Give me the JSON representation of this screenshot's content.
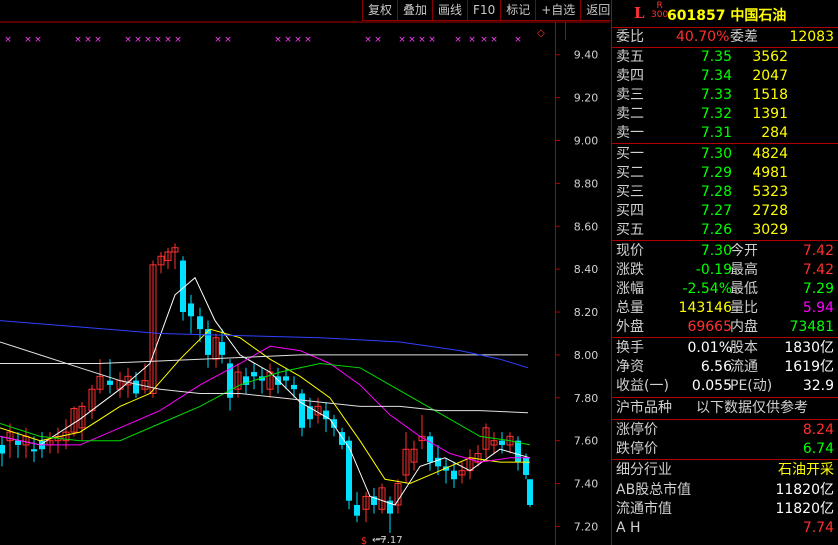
{
  "toolbar": [
    "复权",
    "叠加",
    "画线",
    "F10",
    "标记",
    "+自选",
    "返回"
  ],
  "stock": {
    "prefix": "L",
    "badge_top": "R",
    "badge_bottom": "300",
    "code_name": "601857 中国石油"
  },
  "weibi": {
    "label1": "委比",
    "value1": "40.70%",
    "label2": "委差",
    "value2": "12083"
  },
  "asks": [
    {
      "label": "卖五",
      "price": "7.35",
      "vol": "3562"
    },
    {
      "label": "卖四",
      "price": "7.34",
      "vol": "2047"
    },
    {
      "label": "卖三",
      "price": "7.33",
      "vol": "1518"
    },
    {
      "label": "卖二",
      "price": "7.32",
      "vol": "1391"
    },
    {
      "label": "卖一",
      "price": "7.31",
      "vol": "284"
    }
  ],
  "bids": [
    {
      "label": "买一",
      "price": "7.30",
      "vol": "4824"
    },
    {
      "label": "买二",
      "price": "7.29",
      "vol": "4981"
    },
    {
      "label": "买三",
      "price": "7.28",
      "vol": "5323"
    },
    {
      "label": "买四",
      "price": "7.27",
      "vol": "2728"
    },
    {
      "label": "买五",
      "price": "7.26",
      "vol": "3029"
    }
  ],
  "quote": [
    {
      "l1": "现价",
      "v1": "7.30",
      "l2": "今开",
      "v2": "7.42",
      "c1": "green",
      "c2": "red"
    },
    {
      "l1": "涨跌",
      "v1": "-0.19",
      "l2": "最高",
      "v2": "7.42",
      "c1": "green",
      "c2": "red"
    },
    {
      "l1": "涨幅",
      "v1": "-2.54%",
      "l2": "最低",
      "v2": "7.29",
      "c1": "green",
      "c2": "green"
    },
    {
      "l1": "总量",
      "v1": "143146",
      "l2": "量比",
      "v2": "5.94",
      "c1": "yellow",
      "c2": "magenta"
    },
    {
      "l1": "外盘",
      "v1": "69665",
      "l2": "内盘",
      "v2": "73481",
      "c1": "red",
      "c2": "green"
    }
  ],
  "fund": [
    {
      "l1": "换手",
      "v1": "0.01%",
      "l2": "股本",
      "v2": "1830亿"
    },
    {
      "l1": "净资",
      "v1": "6.56",
      "l2": "流通",
      "v2": "1619亿"
    },
    {
      "l1": "收益(一)",
      "v1": "0.055",
      "l2": "PE(动)",
      "v2": "32.9"
    }
  ],
  "market": {
    "label": "沪市品种",
    "note": "以下数据仅供参考"
  },
  "limits": [
    {
      "label": "涨停价",
      "value": "8.24",
      "color": "red"
    },
    {
      "label": "跌停价",
      "value": "6.74",
      "color": "green"
    }
  ],
  "industry": {
    "label": "细分行业",
    "value": "石油开采"
  },
  "caps": [
    {
      "label": "AB股总市值",
      "value": "11820亿"
    },
    {
      "label": "流通市值",
      "value": "11820亿"
    }
  ],
  "ah": {
    "label": "A H",
    "value": "7.74"
  },
  "chart_data": {
    "type": "candlestick",
    "y_ticks": [
      "9.40",
      "9.20",
      "9.00",
      "8.80",
      "8.60",
      "8.40",
      "8.20",
      "8.00",
      "7.80",
      "7.60",
      "7.40",
      "7.20"
    ],
    "ylim": [
      7.16,
      9.52
    ],
    "low_annotation": "7.17",
    "colors": {
      "up": "#ff3030",
      "down": "#00e0ff",
      "ma5": "#ffffff",
      "ma10": "#ffff00",
      "ma20": "#ff00ff",
      "ma30": "#00dd00",
      "ma60": "#e0e0e0",
      "ma120": "#3040ff"
    }
  }
}
